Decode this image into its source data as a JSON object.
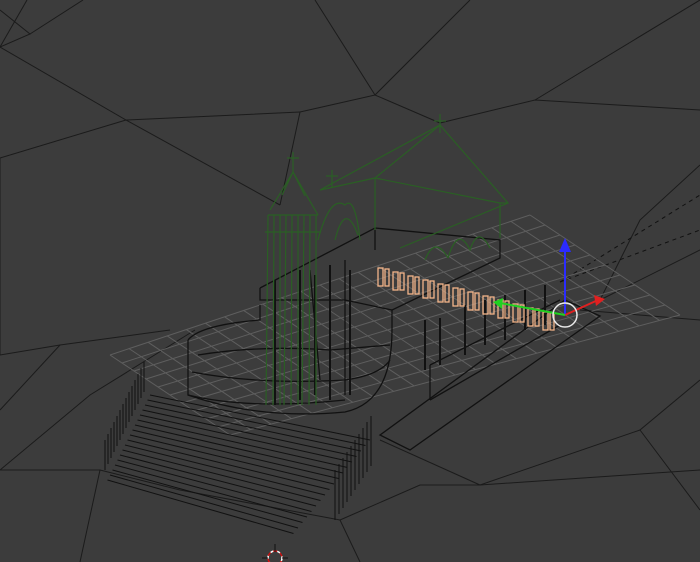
{
  "viewport": {
    "mode": "wireframe",
    "colors": {
      "background": "#3c3c3c",
      "terrain_edge": "#1b1b1b",
      "grid": "#5e5e5e",
      "wire_unselected": "#000000",
      "wire_selected_object": "#2a5f24",
      "wire_active_selection": "#f3b58a",
      "axis_x": "#e02020",
      "axis_y": "#20d020",
      "axis_z": "#2b2bff"
    },
    "objects": [
      {
        "name": "terrain",
        "icon": "terrain-mesh",
        "selected": false
      },
      {
        "name": "ground-grid",
        "icon": "grid",
        "selected": false
      },
      {
        "name": "church-building",
        "icon": "church-mesh",
        "selected": true
      },
      {
        "name": "cathedral-platform",
        "icon": "building-mesh",
        "selected": false
      },
      {
        "name": "arcade-columns",
        "icon": "column-mesh",
        "selected": true
      },
      {
        "name": "stairs",
        "icon": "stairs-mesh",
        "selected": false
      }
    ],
    "gizmo": {
      "type": "translate-manipulator",
      "axes": [
        "x",
        "y",
        "z"
      ]
    },
    "cursor_3d": {
      "icon": "crosshair-3d-cursor"
    }
  }
}
